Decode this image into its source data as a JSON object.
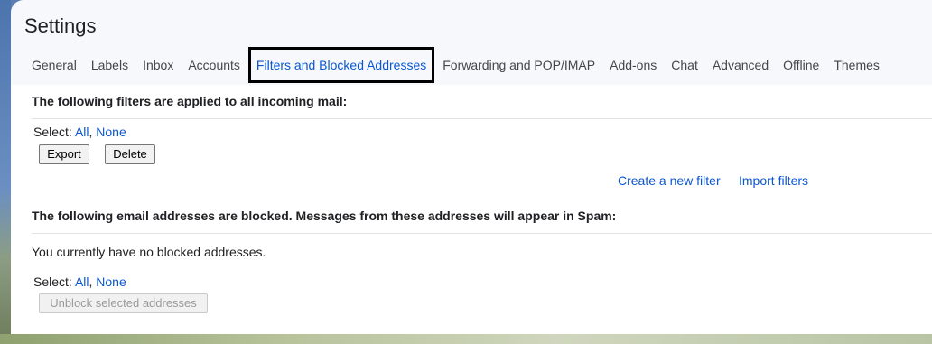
{
  "page_title": "Settings",
  "tabs": [
    {
      "label": "General"
    },
    {
      "label": "Labels"
    },
    {
      "label": "Inbox"
    },
    {
      "label": "Accounts"
    },
    {
      "label": "Filters and Blocked Addresses",
      "active": true
    },
    {
      "label": "Forwarding and POP/IMAP"
    },
    {
      "label": "Add-ons"
    },
    {
      "label": "Chat"
    },
    {
      "label": "Advanced"
    },
    {
      "label": "Offline"
    },
    {
      "label": "Themes"
    }
  ],
  "filters": {
    "heading": "The following filters are applied to all incoming mail:",
    "select_label": "Select:",
    "select_all": "All",
    "separator": ",",
    "select_none": "None",
    "export_label": "Export",
    "delete_label": "Delete",
    "create_filter_link": "Create a new filter",
    "import_filters_link": "Import filters"
  },
  "blocked": {
    "heading": "The following email addresses are blocked. Messages from these addresses will appear in Spam:",
    "empty_message": "You currently have no blocked addresses.",
    "select_label": "Select:",
    "select_all": "All",
    "separator": ",",
    "select_none": "None",
    "unblock_label": "Unblock selected addresses"
  },
  "colors": {
    "accent": "#0b57d0",
    "active_tab_outline": "#000000",
    "panel_bg": "#f6f8fc",
    "content_bg": "#ffffff"
  }
}
